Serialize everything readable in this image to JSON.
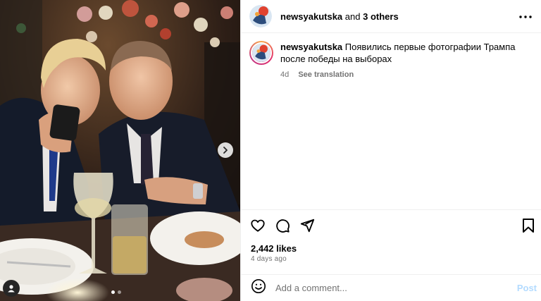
{
  "header": {
    "username": "newsyakutska",
    "connector": "and",
    "others": "3 others"
  },
  "caption": {
    "username": "newsyakutska",
    "text": "Появились первые фотографии Трампа после победы на выборах",
    "age": "4d",
    "see_translation": "See translation"
  },
  "media": {
    "carousel": {
      "total": 2,
      "current": 1
    }
  },
  "stats": {
    "likes": "2,442 likes",
    "ago": "4 days ago"
  },
  "comment": {
    "placeholder": "Add a comment...",
    "post_label": "Post"
  },
  "icons": {
    "header_more": "more-horizontal-icon",
    "like": "heart-icon",
    "comment": "comment-icon",
    "share": "send-icon",
    "save": "bookmark-icon",
    "emoji": "emoji-icon",
    "next": "chevron-right-icon",
    "tag": "user-tag-icon"
  },
  "colors": {
    "post_button": "#b3dbff",
    "secondary_text": "#737373",
    "divider": "#efefef"
  }
}
